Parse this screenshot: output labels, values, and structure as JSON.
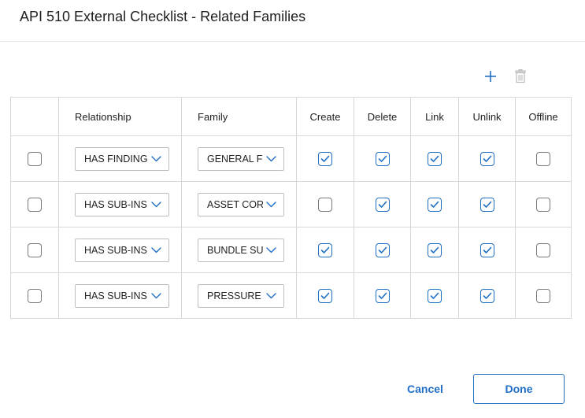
{
  "dialog": {
    "title": "API 510 External Checklist - Related Families"
  },
  "toolbar": {
    "add_icon": "plus-icon",
    "delete_icon": "trash-icon",
    "accent_color": "#1f6fc5",
    "disabled_color": "#b9b9b9"
  },
  "table": {
    "columns": [
      "",
      "Relationship",
      "Family",
      "Create",
      "Delete",
      "Link",
      "Unlink",
      "Offline"
    ],
    "rows": [
      {
        "selected": false,
        "relationship": "HAS FINDING",
        "family": "GENERAL FI",
        "create": true,
        "delete": true,
        "link": true,
        "unlink": true,
        "offline": false
      },
      {
        "selected": false,
        "relationship": "HAS SUB-INS",
        "family": "ASSET CORI",
        "create": false,
        "delete": true,
        "link": true,
        "unlink": true,
        "offline": false
      },
      {
        "selected": false,
        "relationship": "HAS SUB-INS",
        "family": "BUNDLE SU",
        "create": true,
        "delete": true,
        "link": true,
        "unlink": true,
        "offline": false
      },
      {
        "selected": false,
        "relationship": "HAS SUB-INS",
        "family": "PRESSURE T",
        "create": true,
        "delete": true,
        "link": true,
        "unlink": true,
        "offline": false
      }
    ]
  },
  "footer": {
    "cancel_label": "Cancel",
    "done_label": "Done"
  }
}
